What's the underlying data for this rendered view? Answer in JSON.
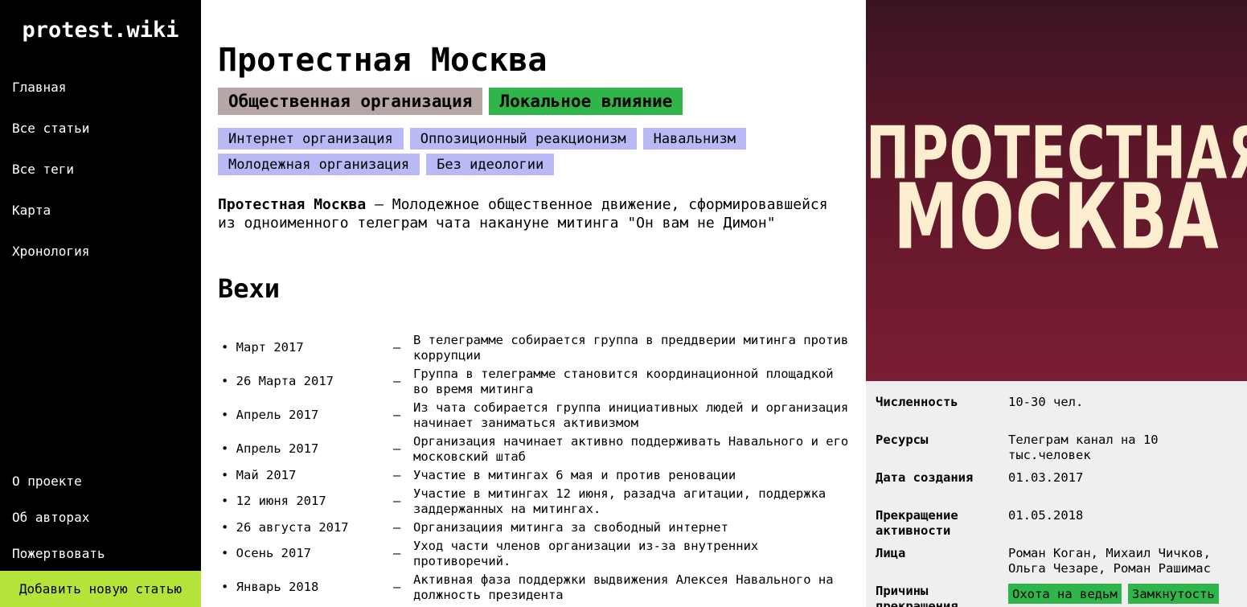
{
  "sidebar": {
    "logo": "protest.wiki",
    "nav": [
      "Главная",
      "Все статьи",
      "Все теги",
      "Карта",
      "Хронология"
    ],
    "footer_nav": [
      "О проекте",
      "Об авторах",
      "Пожертвовать"
    ],
    "add_article": "Добавить новую статью"
  },
  "article": {
    "title": "Протестная Москва",
    "type_badge": "Общественная организация",
    "scope_badge": "Локальное влияние",
    "tags": [
      "Интернет организация",
      "Оппозиционный реакционизм",
      "Навальнизм",
      "Молодежная организация",
      "Без идеологии"
    ],
    "intro_name": "Протестная Москва",
    "intro_text": " – Молодежное общественное движение, сформировавшейся из одноименного телеграм чата накануне митинга \"Он вам не Димон\"",
    "milestones_title": "Вехи",
    "milestones": [
      {
        "date": "• Март 2017",
        "dash": "—",
        "text": "В телеграмме собирается группа в преддверии митинга против коррупции"
      },
      {
        "date": "• 26 Марта 2017",
        "dash": "—",
        "text": "Группа в телеграмме становится координационной площадкой во время митинга"
      },
      {
        "date": "• Апрель 2017",
        "dash": "—",
        "text": "Из чата собирается группа инициативных людей и организация начинает заниматься активизмом"
      },
      {
        "date": "• Апрель 2017",
        "dash": "—",
        "text": "Организация начинает активно поддерживать Навального и его московский штаб"
      },
      {
        "date": "• Май 2017",
        "dash": "—",
        "text": "Участие в митингах 6 мая и против реновации"
      },
      {
        "date": "• 12 июня 2017",
        "dash": "—",
        "text": "Участие в митингах 12 июня, разадча агитации, поддержка заддержанных на митингах."
      },
      {
        "date": "• 26 августа 2017",
        "dash": "—",
        "text": "Организациия митинга за свободный интернет"
      },
      {
        "date": "• Осень 2017",
        "dash": "—",
        "text": "Уход части членов организации из-за внутренних противоречий."
      },
      {
        "date": "• Январь 2018",
        "dash": "—",
        "text": "Активная фаза поддержки выдвижения Алексея Навального на должность президента"
      }
    ]
  },
  "poster": {
    "line1": "ПРОТЕСТНАЯ",
    "line2": "МОСКВА"
  },
  "infobox": {
    "size_label": "Численность",
    "size_value": "10-30 чел.",
    "resources_label": "Ресурсы",
    "resources_value": "Телеграм канал на 10 тыс.человек",
    "created_label": "Дата создания",
    "created_value": "01.03.2017",
    "ended_label": "Прекращение активности",
    "ended_value": "01.05.2018",
    "people_label": "Лица",
    "people_value": "Роман Коган, Михаил Чичков, Ольга Чезаре, Роман Рашимас",
    "reasons_label": "Причины прекращения",
    "reasons": [
      "Охота на ведьм",
      "Замкнутость"
    ]
  }
}
